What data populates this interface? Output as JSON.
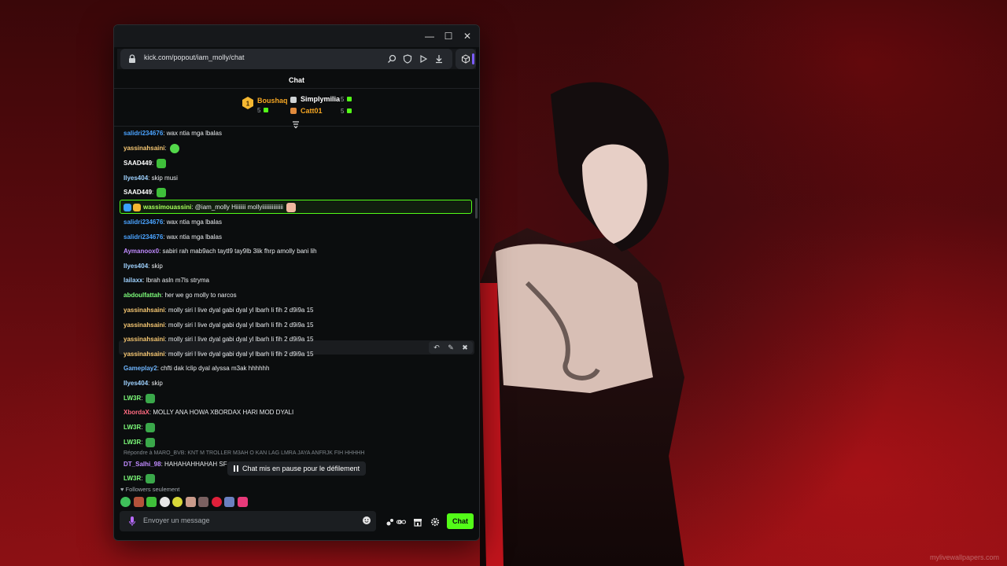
{
  "browser": {
    "url": "kick.com/popout/iam_molly/chat",
    "minimize": "—",
    "maximize": "☐",
    "close": "✕"
  },
  "chat": {
    "title": "Chat",
    "leaderboard": [
      {
        "name": "Boushaq",
        "count": "5",
        "color": "#f5a623"
      },
      {
        "name": "Simplymilia",
        "count": "5",
        "color": "#ffffff"
      },
      {
        "name": "Catt01",
        "count": "5",
        "color": "#f5a623"
      }
    ],
    "messages": [
      {
        "user": "salidri234676",
        "text": ": wax ntia mga lbalas",
        "color": "#4aa3ff",
        "emote": ""
      },
      {
        "user": "yassinahsaini",
        "text": ":",
        "color": "#f7c873",
        "emote": "green-blob"
      },
      {
        "user": "SAAD449",
        "text": ":",
        "color": "#ffffff",
        "emote": "green-cactus"
      },
      {
        "user": "Ilyes404",
        "text": ": skip musi",
        "color": "#9fd2ff",
        "emote": ""
      },
      {
        "user": "SAAD449",
        "text": ":",
        "color": "#ffffff",
        "emote": "green-cactus"
      },
      {
        "user": "wassimouassini",
        "text": ": @iam_molly Hiiiiiii mollyiiiiiiiiiiiiiii",
        "color": "#a6ff5c",
        "emote": "hand-rocket"
      },
      {
        "user": "salidri234676",
        "text": ": wax ntia mga lbalas",
        "color": "#4aa3ff",
        "emote": ""
      },
      {
        "user": "salidri234676",
        "text": ": wax ntia mga lbalas",
        "color": "#4aa3ff",
        "emote": ""
      },
      {
        "user": "Aymanoox0",
        "text": ": sabiri rah mab9ach taytl9 tay9lb 3lik fhrp amolly bani lih",
        "color": "#c08bff",
        "emote": ""
      },
      {
        "user": "Ilyes404",
        "text": ": skip",
        "color": "#9fd2ff",
        "emote": ""
      },
      {
        "user": "lailaxx",
        "text": ": lbrah asln m7ls stryma",
        "color": "#9fd2ff",
        "emote": ""
      },
      {
        "user": "abdoulfattah",
        "text": ": her we go molly to narcos",
        "color": "#7dfc7a",
        "emote": ""
      },
      {
        "user": "yassinahsaini",
        "text": ": molly siri l live dyal gabi dyal yl lbarh li fih 2 d9i9a 15",
        "color": "#f7c873",
        "emote": ""
      },
      {
        "user": "yassinahsaini",
        "text": ": molly siri l live dyal gabi dyal yl lbarh li fih 2 d9i9a 15",
        "color": "#f7c873",
        "emote": ""
      },
      {
        "user": "yassinahsaini",
        "text": ": molly siri l live dyal gabi dyal yl lbarh li fih 2 d9i9a 15",
        "color": "#f7c873",
        "emote": ""
      },
      {
        "user": "yassinahsaini",
        "text": ": molly siri l live dyal gabi dyal yl lbarh li fih 2 d9i9a 15",
        "color": "#f7c873",
        "emote": ""
      },
      {
        "user": "Gameplay2",
        "text": ": chfti dak lclip dyal alyssa m3ak hhhhhh",
        "color": "#6fb6ff",
        "emote": ""
      },
      {
        "user": "Ilyes404",
        "text": ": skip",
        "color": "#9fd2ff",
        "emote": ""
      },
      {
        "user": "LW3R",
        "text": ":",
        "color": "#7dfc7a",
        "emote": "pepe"
      },
      {
        "user": "XbordaX",
        "text": ": MOLLY ANA HOWA XBORDAX HARI MOD DYALI",
        "color": "#ff6b81",
        "emote": ""
      },
      {
        "user": "LW3R",
        "text": ":",
        "color": "#7dfc7a",
        "emote": "pepe"
      },
      {
        "user": "LW3R",
        "text": ":",
        "color": "#7dfc7a",
        "emote": "pepe"
      },
      {
        "user": "DT_Salhi_98",
        "text": ": HAHAHAHHAHAH SF",
        "color": "#c08bff",
        "emote": ""
      },
      {
        "user": "LW3R",
        "text": ":",
        "color": "#7dfc7a",
        "emote": "pepe"
      }
    ],
    "reply_context": "Répondre à MARO_BVB: KNT M TROLLER M3AH O KAN LAG LMRA JAYA ANFRJK FIH HHHHH",
    "paused_label": "Chat mis en pause pour le défilement",
    "followers_only": "Followers seulement",
    "input_placeholder": "Envoyer un message",
    "send_label": "Chat"
  },
  "watermark": "mylivewallpapers.com",
  "colors": {
    "accent": "#53fc18",
    "background": "#0b0d0e"
  }
}
